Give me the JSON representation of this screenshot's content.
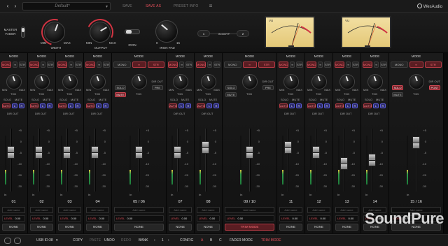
{
  "topbar": {
    "preset_name": "Default*",
    "save_label": "SAVE",
    "save_as_label": "SAVE AS",
    "preset_info_label": "PRESET INFO",
    "brand": "WesAudio"
  },
  "master": {
    "master_fader_label": "MASTER\nFADER",
    "width_label": "WIDTH",
    "output_label": "OUTPUT",
    "iron_label": "IRON",
    "iron_pad_label": "IRON PAD",
    "knob_min": "MIN",
    "knob_max": "MAX",
    "iron_pad_min": "0",
    "iron_pad_max": "15",
    "insert_label": "INSERT",
    "insert_1": "1",
    "insert_2": "2",
    "vu_label": "VU",
    "vu_scale": [
      "-20",
      "-10",
      "-7",
      "-5",
      "-3",
      "-1",
      "0",
      "+1",
      "+2",
      "+3"
    ]
  },
  "strips": [
    {
      "name": "01",
      "level": "0.00",
      "mode": "MONO",
      "fader": 0.62,
      "meter": 0.3,
      "solo": false,
      "mute": false,
      "dir_out": "",
      "output": "NONE"
    },
    {
      "name": "02",
      "level": "0.00",
      "mode": "MONO",
      "fader": 0.62,
      "meter": 0.3,
      "solo": false,
      "mute": false,
      "dir_out": "",
      "output": "NONE"
    },
    {
      "name": "03",
      "level": "0.00",
      "mode": "MONO",
      "fader": 0.62,
      "meter": 0.3,
      "solo": false,
      "mute": false,
      "dir_out": "",
      "output": "NONE"
    },
    {
      "name": "04",
      "level": "0.00",
      "mode": "MONO",
      "fader": 0.62,
      "meter": 0.3,
      "solo": false,
      "mute": false,
      "dir_out": "",
      "output": "NONE"
    },
    {
      "name": "05 / 06",
      "level": "0.00",
      "mode": "STR",
      "fader": 0.62,
      "meter": 0.3,
      "solo": false,
      "mute": true,
      "dir_out": "PRE",
      "output": "NONE"
    },
    {
      "name": "07",
      "level": "0.00",
      "mode": "MONO",
      "fader": 0.62,
      "meter": 0.3,
      "solo": false,
      "mute": false,
      "dir_out": "",
      "output": "NONE"
    },
    {
      "name": "08",
      "level": "0.00",
      "mode": "MONO",
      "fader": 0.7,
      "meter": 0.3,
      "solo": false,
      "mute": false,
      "dir_out": "",
      "output": "NONE"
    },
    {
      "name": "09 / 10",
      "level": "0.00",
      "mode": "STR",
      "fader": 0.62,
      "meter": 0.3,
      "solo": false,
      "mute": false,
      "dir_out": "PRE",
      "output": "TRIM MODE"
    },
    {
      "name": "11",
      "level": "0.00",
      "mode": "MONO",
      "fader": 0.7,
      "meter": 0.3,
      "solo": false,
      "mute": false,
      "dir_out": "",
      "output": "NONE"
    },
    {
      "name": "12",
      "level": "0.00",
      "mode": "MONO",
      "fader": 0.62,
      "meter": 0.3,
      "solo": false,
      "mute": false,
      "dir_out": "",
      "output": "NONE"
    },
    {
      "name": "13",
      "level": "0.00",
      "mode": "MONO",
      "fader": 0.45,
      "meter": 0.3,
      "solo": false,
      "mute": false,
      "dir_out": "",
      "output": "NONE"
    },
    {
      "name": "14",
      "level": "0.00",
      "mode": "MONO",
      "fader": 0.5,
      "meter": 0.3,
      "solo": false,
      "mute": false,
      "dir_out": "",
      "output": "NONE"
    },
    {
      "name": "15 / 16",
      "level": "0.00",
      "mode": "STR",
      "fader": 0.78,
      "meter": 0.3,
      "solo": true,
      "mute": false,
      "dir_out": "POST",
      "output": "NONE"
    }
  ],
  "strip_labels": {
    "mode": "MODE",
    "mono": "MONO",
    "str": "STR",
    "thd": "THD",
    "min": "MIN",
    "max": "MAX",
    "solo": "SOLO",
    "mute": "MUTE",
    "auto": "AUTO",
    "l": "L",
    "r": "R",
    "dir_out": "DIR OUT",
    "pre": "PRE",
    "post": "POST",
    "add_name": "Add name",
    "level": "LEVEL",
    "in": "In",
    "scale": [
      "+5",
      "0",
      "-5",
      "-10",
      "-20",
      "-30"
    ]
  },
  "footer": {
    "usb_id": "USB ID:38",
    "copy": "COPY",
    "paste": "PASTE",
    "undo": "UNDO",
    "redo": "REDO",
    "bank": "BANK",
    "bank_value": "1",
    "config": "CONFIG",
    "a": "A",
    "b": "B",
    "c": "C",
    "fader_mode": "FADER MODE",
    "trim_mode": "TRIM MODE"
  },
  "watermark": "SoundPure",
  "colors": {
    "accent": "#e8505b",
    "meter_green": "#2f9d4c",
    "panel": "#161616"
  }
}
